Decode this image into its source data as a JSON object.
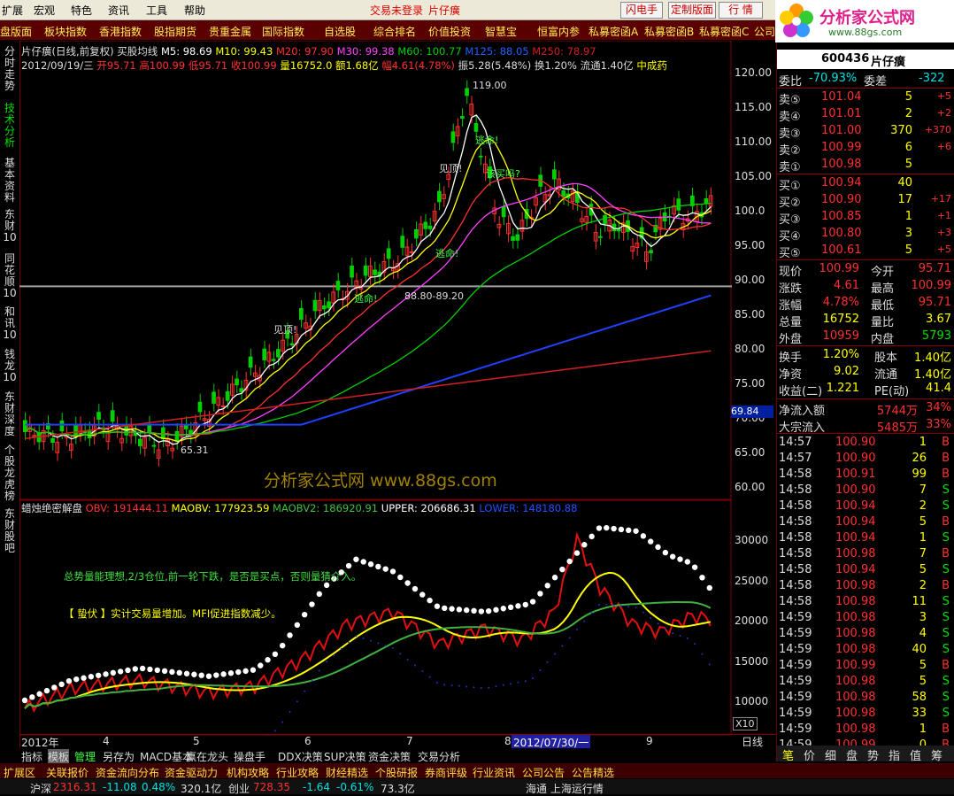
{
  "menubar": {
    "items": [
      "扩展",
      "宏观",
      "特色",
      "资讯",
      "工具",
      "帮助"
    ],
    "login_status": "交易未登录",
    "stock_name": "片仔癀",
    "btn_flash": "闪电手",
    "btn_custom": "定制版面",
    "btn_quote": "行 情"
  },
  "logo": {
    "title": "分析家公式网",
    "url": "www.88gs.com"
  },
  "navbar": [
    "盘版面",
    "板块指数",
    "香港指数",
    "股指期货",
    "贵重金属",
    "国际指数",
    "自选股",
    "综合排名",
    "价值投资",
    "智慧宝",
    "恒富内参",
    "私募密函A",
    "私募密函B",
    "私募密函C",
    "公司"
  ],
  "lefttabs": [
    "分时走势",
    "技术分析",
    "基本资料",
    "东财10",
    "同花顺10",
    "和讯10",
    "钱龙10",
    "东财深度",
    "个股龙虎榜",
    "东财股吧"
  ],
  "upper": {
    "title": "片仔癀(日线,前复权) 买股均线",
    "ma": {
      "m5": "M5: 98.69",
      "m10": "M10: 99.43",
      "m20": "M20: 97.90",
      "m30": "M30: 99.38",
      "m60": "M60: 100.77",
      "m125": "M125: 88.05",
      "m250": "M250: 78.97"
    },
    "bar_date": "2012/09/19/三",
    "open": "开95.71",
    "high": "高100.99",
    "low": "低95.71",
    "close": "收100.99",
    "vol": "量16752.0",
    "amount": "额1.68亿",
    "chg": "幅4.61(4.78%)",
    "amp": "振5.28(5.48%)",
    "turnover": "换1.20%",
    "float": "流通1.40亿",
    "sector": "中成药",
    "labels": {
      "peak": "119.00",
      "low": "65.31",
      "band": "88.80-89.20",
      "flee": "逃命!",
      "top": "见顶!",
      "buy": "该买吗?",
      "cur": "69.84"
    },
    "watermark": "分析家公式网 www.88gs.com",
    "ticks": [
      "120.00",
      "115.00",
      "110.00",
      "105.00",
      "100.0",
      "95.00",
      "90.00",
      "85.00",
      "80.00",
      "75.00",
      "70.00",
      "65.00",
      "60.00"
    ]
  },
  "lower": {
    "title": "蜡烛绝密解盘",
    "obv": "OBV: 191444.11",
    "maobv": "MAOBV: 177923.59",
    "maobv2": "MAOBV2: 186920.91",
    "upper": "UPPER: 206686.31",
    "lowerv": "LOWER: 148180.88",
    "text1": "总势量能理想,2/3仓位,前一轮下跌，是否是买点，否则量猜介入。",
    "text2": "【 蛰伏 】实计交易量增加。MFI促进指数减少。",
    "ticks": [
      "30000",
      "25000",
      "20000",
      "15000",
      "10000"
    ],
    "x10": "X10"
  },
  "xaxis": {
    "labels": [
      "2012年",
      "4",
      "5",
      "6",
      "7",
      "8",
      "9"
    ],
    "cursor_date": "2012/07/30/一",
    "period": "日线"
  },
  "right": {
    "code": "600436",
    "name": "片仔癀",
    "weibi_label": "委比",
    "weibi": "-70.93%",
    "weicha_label": "委差",
    "weicha": "-322",
    "asks": [
      {
        "l": "卖⑤",
        "p": "101.04",
        "v": "5",
        "c": "+5"
      },
      {
        "l": "卖④",
        "p": "101.01",
        "v": "2",
        "c": "+2"
      },
      {
        "l": "卖③",
        "p": "101.00",
        "v": "370",
        "c": "+370"
      },
      {
        "l": "卖②",
        "p": "100.99",
        "v": "6",
        "c": "+6"
      },
      {
        "l": "卖①",
        "p": "100.98",
        "v": "5",
        "c": ""
      }
    ],
    "bids": [
      {
        "l": "买①",
        "p": "100.94",
        "v": "40",
        "c": ""
      },
      {
        "l": "买②",
        "p": "100.90",
        "v": "17",
        "c": "+17"
      },
      {
        "l": "买③",
        "p": "100.85",
        "v": "1",
        "c": "+1"
      },
      {
        "l": "买④",
        "p": "100.80",
        "v": "3",
        "c": "+3"
      },
      {
        "l": "买⑤",
        "p": "100.61",
        "v": "5",
        "c": "+5"
      }
    ],
    "stats": [
      {
        "a": "现价",
        "av": "100.99",
        "b": "今开",
        "bv": "95.71"
      },
      {
        "a": "涨跌",
        "av": "4.61",
        "b": "最高",
        "bv": "100.99"
      },
      {
        "a": "涨幅",
        "av": "4.78%",
        "b": "最低",
        "bv": "95.71"
      },
      {
        "a": "总量",
        "av": "16752",
        "b": "量比",
        "bv": "3.67"
      },
      {
        "a": "外盘",
        "av": "10959",
        "b": "内盘",
        "bv": "5793"
      }
    ],
    "stats2": [
      {
        "a": "换手",
        "av": "1.20%",
        "b": "股本",
        "bv": "1.40亿"
      },
      {
        "a": "净资",
        "av": "9.02",
        "b": "流通",
        "bv": "1.40亿"
      },
      {
        "a": "收益(二)",
        "av": "1.221",
        "b": "PE(动)",
        "bv": "41.4"
      }
    ],
    "flow": [
      {
        "a": "净流入额",
        "v": "5744万",
        "p": "34%"
      },
      {
        "a": "大宗流入",
        "v": "5485万",
        "p": "33%"
      }
    ],
    "ticks": [
      {
        "t": "14:57",
        "p": "100.90",
        "v": "1",
        "d": "B"
      },
      {
        "t": "14:57",
        "p": "100.90",
        "v": "26",
        "d": "B"
      },
      {
        "t": "14:58",
        "p": "100.91",
        "v": "99",
        "d": "B"
      },
      {
        "t": "14:58",
        "p": "100.90",
        "v": "7",
        "d": "S"
      },
      {
        "t": "14:58",
        "p": "100.94",
        "v": "2",
        "d": "S"
      },
      {
        "t": "14:58",
        "p": "100.94",
        "v": "5",
        "d": "B"
      },
      {
        "t": "14:58",
        "p": "100.94",
        "v": "1",
        "d": "S"
      },
      {
        "t": "14:58",
        "p": "100.98",
        "v": "7",
        "d": "B"
      },
      {
        "t": "14:58",
        "p": "100.94",
        "v": "5",
        "d": "S"
      },
      {
        "t": "14:58",
        "p": "100.98",
        "v": "2",
        "d": "B"
      },
      {
        "t": "14:58",
        "p": "100.98",
        "v": "11",
        "d": "S"
      },
      {
        "t": "14:59",
        "p": "100.98",
        "v": "3",
        "d": "S"
      },
      {
        "t": "14:59",
        "p": "100.98",
        "v": "4",
        "d": "S"
      },
      {
        "t": "14:59",
        "p": "100.98",
        "v": "40",
        "d": "S"
      },
      {
        "t": "14:59",
        "p": "100.99",
        "v": "5",
        "d": "B"
      },
      {
        "t": "14:59",
        "p": "100.98",
        "v": "5",
        "d": "S"
      },
      {
        "t": "14:59",
        "p": "100.98",
        "v": "58",
        "d": "S"
      },
      {
        "t": "14:59",
        "p": "100.98",
        "v": "33",
        "d": "S"
      },
      {
        "t": "14:59",
        "p": "100.98",
        "v": "1",
        "d": "B"
      },
      {
        "t": "14:59",
        "p": "100.99",
        "v": "0",
        "d": "B"
      }
    ],
    "bottom_tabs": [
      "笔",
      "价",
      "细",
      "盘",
      "势",
      "指",
      "值",
      "筹"
    ]
  },
  "tabbar": [
    "指标",
    "模板",
    "管理",
    "另存为",
    "MACD基本",
    "赢在龙头",
    "操盘手",
    "DDX决策",
    "SUP决策",
    "资金决策",
    "交易分析"
  ],
  "bottombar2": [
    "扩展区",
    "关联报价",
    "资金流向分布",
    "资金驱动力",
    "机构攻略",
    "行业攻略",
    "财经精选",
    "个股研报",
    "券商评级",
    "行业资讯",
    "公司公告",
    "公告精选"
  ],
  "bottombar3": {
    "idx": "沪深",
    "v1": "2316.31",
    "v2": "-11.08",
    "v3": "0.48%",
    "v4": "320.1亿",
    "lbl": "创业",
    "v5": "728.35",
    "v6": "-1.64",
    "v7": "-0.61%",
    "v8": "73.3亿",
    "news": "海通 上海运行情"
  },
  "colors": {
    "up": "#ff3030",
    "down": "#00e6e6",
    "ma5": "#ffffff",
    "ma10": "#ffff00",
    "ma20": "#ff3030",
    "ma30": "#ff40ff",
    "ma60": "#00d000",
    "ma125": "#2040ff",
    "ma250": "#d02020",
    "bg": "#000000"
  }
}
